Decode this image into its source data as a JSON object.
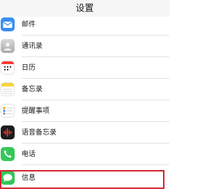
{
  "header": {
    "title": "设置"
  },
  "settings": {
    "items": [
      {
        "label": "邮件",
        "icon": "mail-icon",
        "color": "#3a8ef0"
      },
      {
        "label": "通讯录",
        "icon": "contacts-icon",
        "color": "#bfbfbf"
      },
      {
        "label": "日历",
        "icon": "calendar-icon",
        "color": "#ffffff"
      },
      {
        "label": "备忘录",
        "icon": "notes-icon",
        "color": "#f7d53c"
      },
      {
        "label": "提醒事项",
        "icon": "reminders-icon",
        "color": "#ffffff"
      },
      {
        "label": "语音备忘录",
        "icon": "voice-memos-icon",
        "color": "#1c1c1e"
      },
      {
        "label": "电话",
        "icon": "phone-icon",
        "color": "#35c759"
      },
      {
        "label": "信息",
        "icon": "messages-icon",
        "color": "#35c759"
      }
    ],
    "highlighted_item": "信息",
    "highlight_color": "#d0212b"
  }
}
